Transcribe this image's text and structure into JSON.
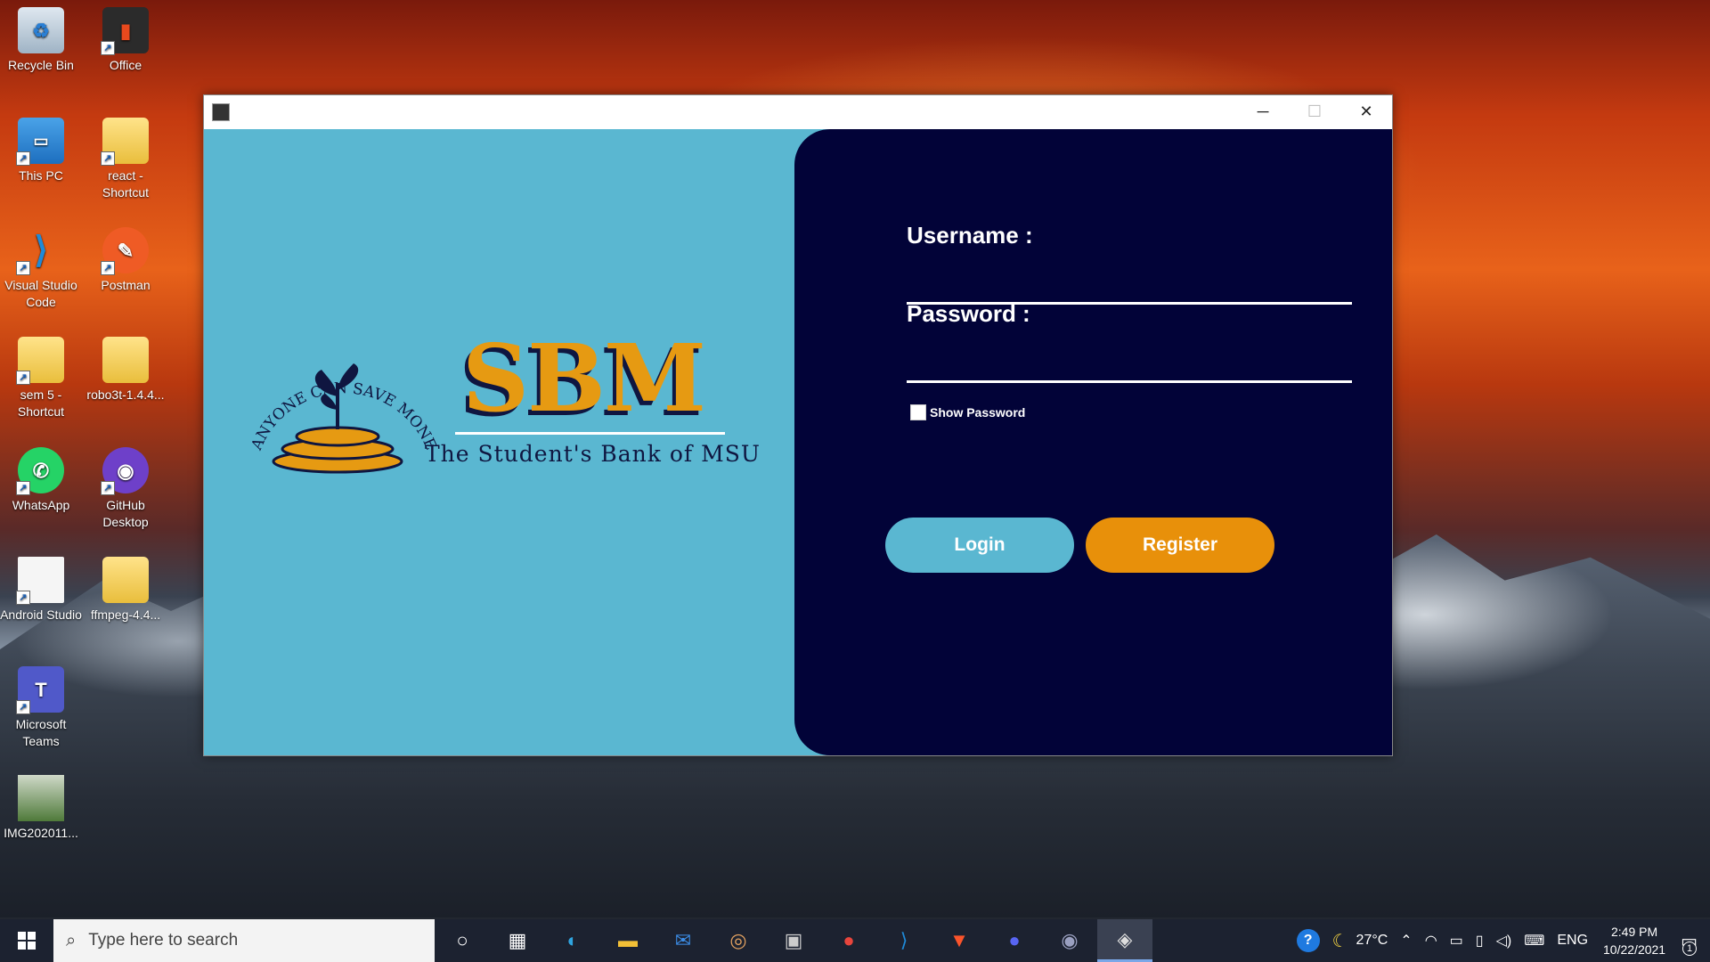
{
  "desktop": {
    "icons": [
      {
        "label": "Recycle Bin"
      },
      {
        "label": "Office"
      },
      {
        "label": "This PC"
      },
      {
        "label": "react - Shortcut"
      },
      {
        "label": "Visual Studio Code"
      },
      {
        "label": "Postman"
      },
      {
        "label": "sem 5 - Shortcut"
      },
      {
        "label": "robo3t-1.4.4..."
      },
      {
        "label": "WhatsApp"
      },
      {
        "label": "GitHub Desktop"
      },
      {
        "label": "Android Studio"
      },
      {
        "label": "ffmpeg-4.4..."
      },
      {
        "label": "Microsoft Teams"
      },
      {
        "label": "IMG202011..."
      }
    ]
  },
  "window": {
    "controls": {
      "minimize": "─",
      "maximize": "☐",
      "close": "✕"
    },
    "left": {
      "arc_text": "ANYONE CAN SAVE MONEY",
      "logo_title": "SBM",
      "tagline": "The Student's Bank of MSU"
    },
    "form": {
      "username_label": "Username :",
      "username_value": "",
      "password_label": "Password :",
      "password_value": "",
      "show_password_label": "Show Password",
      "login_label": "Login",
      "register_label": "Register"
    },
    "colors": {
      "left_bg": "#5ab7d1",
      "right_bg": "#020338",
      "login_btn": "#5ab7d1",
      "register_btn": "#e8900a",
      "logo_gold": "#e69a12"
    }
  },
  "taskbar": {
    "search_placeholder": "Type here to search",
    "weather": "27°C",
    "language": "ENG",
    "time": "2:49 PM",
    "date": "10/22/2021",
    "notification_count": "1"
  }
}
